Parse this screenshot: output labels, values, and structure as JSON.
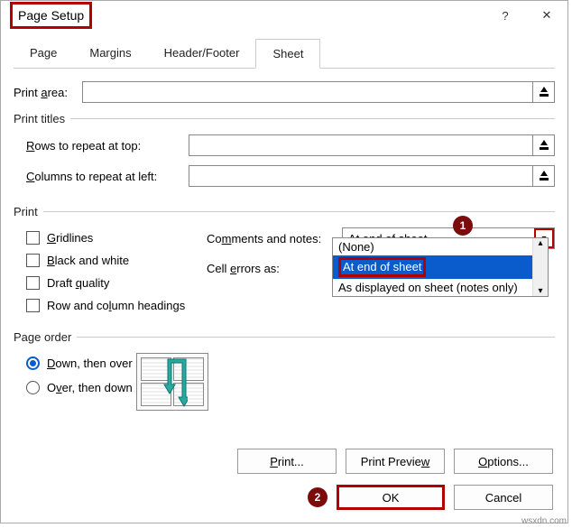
{
  "title": "Page Setup",
  "titlebar": {
    "help": "?",
    "close": "✕"
  },
  "tabs": {
    "page": "Page",
    "margins": "Margins",
    "headerfooter": "Header/Footer",
    "sheet": "Sheet"
  },
  "print_area": {
    "label_pre": "Print ",
    "label_u": "a",
    "label_post": "rea:"
  },
  "print_titles": {
    "legend": "Print titles",
    "rows_u": "R",
    "rows_post": "ows to repeat at top:",
    "cols_u": "C",
    "cols_post": "olumns to repeat at left:"
  },
  "print": {
    "legend": "Print",
    "gridlines_u": "G",
    "gridlines_post": "ridlines",
    "bw_u": "B",
    "bw_post": "lack and white",
    "draft_pre": "Draft ",
    "draft_u": "q",
    "draft_post": "uality",
    "rowcol_pre": "Row and co",
    "rowcol_u": "l",
    "rowcol_post": "umn headings",
    "comments_pre": "Co",
    "comments_u": "m",
    "comments_post": "ments and notes:",
    "cellerr_pre": "Cell ",
    "cellerr_u": "e",
    "cellerr_post": "rrors as:",
    "combo_value": "At end of sheet",
    "dd_none": "(None)",
    "dd_end": "At end of sheet",
    "dd_disp": "As displayed on sheet (notes only)"
  },
  "page_order": {
    "legend": "Page order",
    "down_u": "D",
    "down_post": "own, then over",
    "over_pre": "O",
    "over_u": "v",
    "over_post": "er, then down"
  },
  "buttons": {
    "print_u": "P",
    "print_post": "rint...",
    "preview_pre": "Print Previe",
    "preview_u": "w",
    "options_u": "O",
    "options_post": "ptions...",
    "ok": "OK",
    "cancel": "Cancel"
  },
  "badges": {
    "one": "1",
    "two": "2"
  },
  "watermark": "wsxdn.com"
}
